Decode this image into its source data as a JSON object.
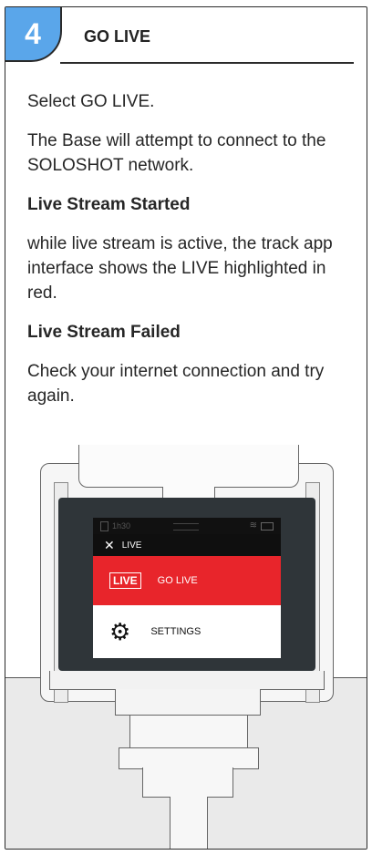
{
  "step": {
    "number": "4",
    "title": "GO LIVE"
  },
  "content": {
    "p1": "Select GO LIVE.",
    "p2": "The Base will attempt to connect to the SOLOSHOT network.",
    "h1": "Live Stream Started",
    "p3": "while live stream is active, the track app interface shows the LIVE highlighted in red.",
    "h2": "Live Stream Failed",
    "p4": "Check your internet connection and try again."
  },
  "device_screen": {
    "status_time": "1h30",
    "top_label": "LIVE",
    "close_symbol": "✕",
    "live_badge": "LIVE",
    "golive_label": "GO LIVE",
    "settings_label": "SETTINGS",
    "icons": [
      "sd-card-icon",
      "signal-bars-icon",
      "wifi-icon",
      "battery-icon",
      "close-icon",
      "gear-icon"
    ]
  },
  "colors": {
    "badge": "#5aa6ea",
    "live_red": "#e8252b",
    "bezel": "#2f3539"
  }
}
